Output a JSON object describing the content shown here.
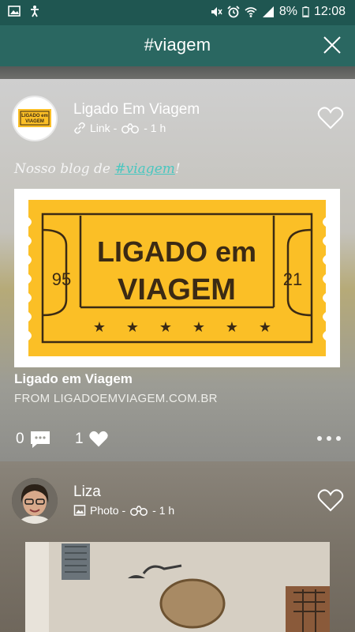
{
  "status_bar": {
    "battery": "8%",
    "time": "12:08"
  },
  "header": {
    "title": "#viagem"
  },
  "posts": [
    {
      "author": "Ligado Em Viagem",
      "type_label": "Link -",
      "time": "- 1 h",
      "text_prefix": "Nosso blog de ",
      "hashtag": "#viagem",
      "text_suffix": "!",
      "link": {
        "logo_title_line1": "LIGADO em",
        "logo_title_line2": "VIAGEM",
        "logo_num_left": "95",
        "logo_num_right": "21",
        "avatar_line1": "LIGADO em",
        "avatar_line2": "VIAGEM",
        "title": "Ligado em Viagem",
        "source": "FROM LIGADOEMVIAGEM.COM.BR"
      },
      "comments": "0",
      "likes": "1"
    },
    {
      "author": "Liza",
      "type_label": "Photo -",
      "time": "- 1 h"
    }
  ],
  "colors": {
    "header": "#2a6761",
    "status_bar": "#1f5651",
    "ticket": "#fbbf26",
    "ticket_ink": "#3b2a14",
    "hashtag": "#49c7c0"
  },
  "icons": [
    "gallery-icon",
    "accessibility-icon",
    "mute-icon",
    "alarm-icon",
    "wifi-icon",
    "signal-icon",
    "battery-icon",
    "close-icon",
    "link-icon",
    "binoculars-icon",
    "heart-outline-icon",
    "comment-icon",
    "heart-filled-icon",
    "more-icon",
    "photo-icon"
  ]
}
